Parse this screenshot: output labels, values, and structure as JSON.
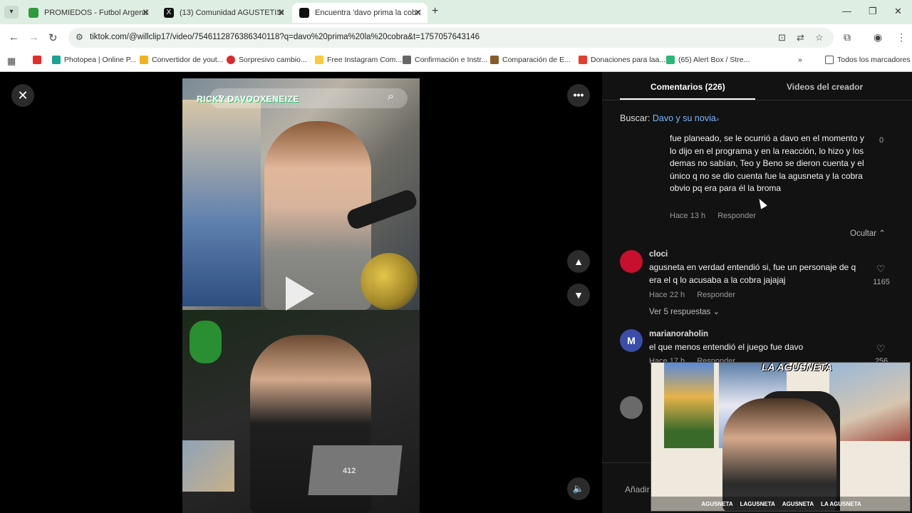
{
  "browser": {
    "tabs": [
      {
        "label": "PROMIEDOS - Futbol Argentino",
        "favicon_color": "#2e9a3a"
      },
      {
        "label": "(13) Comunidad AGUSTETISMO",
        "favicon_color": "#111111"
      },
      {
        "label": "Encuentra 'davo prima la cobra'",
        "favicon_color": "#111111"
      }
    ],
    "url": "tiktok.com/@willclip17/video/7546112876386340118?q=davo%20prima%20la%20cobra&t=1757057643146",
    "bookmarks": [
      {
        "label": "",
        "color": "#e52d27"
      },
      {
        "label": "Photopea | Online P...",
        "color": "#18a497"
      },
      {
        "label": "Convertidor de yout...",
        "color": "#f2b21d"
      },
      {
        "label": "Sorpresivo cambio...",
        "color": "#d92b2b"
      },
      {
        "label": "Free Instagram Com...",
        "color": "#ffc83d"
      },
      {
        "label": "Confirmación e Instr...",
        "color": "#666666"
      },
      {
        "label": "Comparación de E...",
        "color": "#8a5a2a"
      },
      {
        "label": "Donaciones para laa...",
        "color": "#e53d2d"
      },
      {
        "label": "(65) Alert Box / Stre...",
        "color": "#2bb673"
      }
    ],
    "all_bookmarks": "Todos los marcadores"
  },
  "video": {
    "search_query": "Davo y su novia",
    "caption_overlay": "RICKY DAVOOXENEIZE",
    "laptop_text": "412"
  },
  "panel": {
    "tabs": [
      "Comentarios (226)",
      "Videos del creador"
    ],
    "search_prefix": "Buscar:",
    "search_term": "Davo y su novia",
    "comments": [
      {
        "text": "fue planeado, se le ocurrió a davo en el momento y lo dijo en el programa y en la reacción, lo hizo y los demas no sabían, Teo y Beno se dieron cuenta y el único q no se dio cuenta fue la agusneta y la cobra obvio pq era para él la broma",
        "time": "Hace 13 h",
        "reply": "Responder",
        "likes": "0"
      },
      {
        "user": "cloci",
        "text": "agusneta en verdad entendió si, fue un personaje de q era el q lo acusaba a la cobra jajajaj",
        "time": "Hace 22 h",
        "reply": "Responder",
        "likes": "1165",
        "view_replies": "Ver 5 respuestas",
        "avatar_color": "#c8102e"
      },
      {
        "user": "marianoraholin",
        "text": "el que menos entendió el juego fue davo",
        "time": "Hace 17 h",
        "reply": "Responder",
        "likes": "256",
        "avatar_letter": "M",
        "avatar_color": "#3b4da8"
      }
    ],
    "hide_replies": "Ocultar",
    "add_comment": "Añadir"
  },
  "pip": {
    "logo": "LA AGUSNETA",
    "footer": [
      "AGUSNETA",
      "LAGUSNETA",
      "AGUSNETA",
      "LA AGUSNETA"
    ]
  }
}
